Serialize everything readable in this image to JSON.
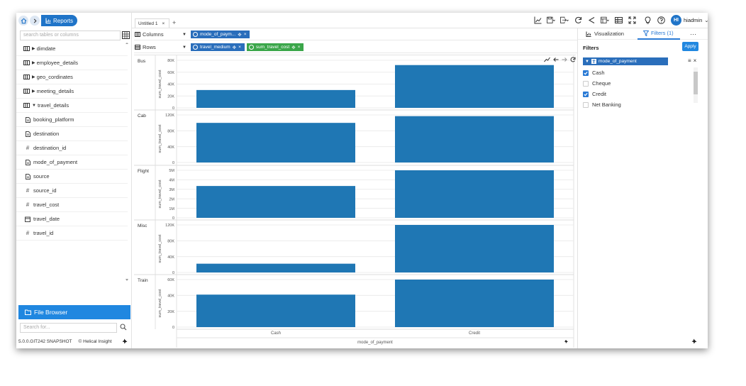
{
  "nav": {
    "reports_label": "Reports"
  },
  "left": {
    "search_placeholder": "search tables or columns",
    "tables": [
      {
        "label": "dimdate",
        "expanded": false
      },
      {
        "label": "employee_details",
        "expanded": false
      },
      {
        "label": "geo_cordinates",
        "expanded": false
      },
      {
        "label": "meeting_details",
        "expanded": false
      },
      {
        "label": "travel_details",
        "expanded": true
      }
    ],
    "columns": [
      {
        "label": "booking_platform",
        "kind": "text"
      },
      {
        "label": "destination",
        "kind": "text"
      },
      {
        "label": "destination_id",
        "kind": "number"
      },
      {
        "label": "mode_of_payment",
        "kind": "text"
      },
      {
        "label": "source",
        "kind": "text"
      },
      {
        "label": "source_id",
        "kind": "number"
      },
      {
        "label": "travel_cost",
        "kind": "number"
      },
      {
        "label": "travel_date",
        "kind": "date"
      },
      {
        "label": "travel_id",
        "kind": "number"
      }
    ],
    "file_browser_label": "File Browser",
    "search_for_placeholder": "Search for...",
    "version": "5.0.0.GIT242 SNAPSHOT",
    "brand": "Helical Insight"
  },
  "tabs": {
    "active": "Untitled 1",
    "close": "×",
    "add": "+"
  },
  "user": {
    "initials": "HI",
    "name": "hiadmin"
  },
  "shelves": {
    "columns_label": "Columns",
    "rows_label": "Rows",
    "column_pills": [
      {
        "label": "mode_of_paym...",
        "color": "#2a6ebb"
      }
    ],
    "row_pills": [
      {
        "label": "travel_medium",
        "color": "#2a6ebb"
      },
      {
        "label": "sum_travel_cost",
        "color": "#3ba64a"
      }
    ]
  },
  "chart_data": {
    "type": "bar",
    "categories": [
      "Cash",
      "Credit"
    ],
    "xlabel": "mode_of_payment",
    "ylabel": "sum_travel_cost",
    "bar_color": "#1f77b4",
    "panels": [
      {
        "row": "Bus",
        "values": [
          30000,
          72000
        ],
        "ymax": 80000,
        "ticks": [
          "0",
          "20K",
          "40K",
          "60K",
          "80K"
        ]
      },
      {
        "row": "Cab",
        "values": [
          100000,
          117000
        ],
        "ymax": 120000,
        "ticks": [
          "0",
          "40K",
          "80K",
          "120K"
        ]
      },
      {
        "row": "Flight",
        "values": [
          3350000,
          5000000
        ],
        "ymax": 5000000,
        "ticks": [
          "0",
          "1M",
          "2M",
          "3M",
          "4M",
          "5M"
        ]
      },
      {
        "row": "Misc",
        "values": [
          24000,
          130000
        ],
        "ymax": 130000,
        "ticks": [
          "0",
          "40K",
          "80K",
          "120K"
        ]
      },
      {
        "row": "Train",
        "values": [
          41000,
          60000
        ],
        "ymax": 60000,
        "ticks": [
          "0",
          "20K",
          "40K",
          "60K"
        ]
      }
    ]
  },
  "right": {
    "tab_visualization": "Visualization",
    "tab_filters": "Filters (1)",
    "more": "···",
    "filters_title": "Filters",
    "apply_label": "Apply",
    "filter_field": "mode_of_payment",
    "options": [
      {
        "label": "Cash",
        "checked": true
      },
      {
        "label": "Cheque",
        "checked": false
      },
      {
        "label": "Credit",
        "checked": true
      },
      {
        "label": "Net Banking",
        "checked": false
      }
    ]
  },
  "colors": {
    "accent": "#2087e0",
    "pill_blue": "#2a6ebb",
    "pill_green": "#3ba64a",
    "bar": "#1f77b4"
  }
}
